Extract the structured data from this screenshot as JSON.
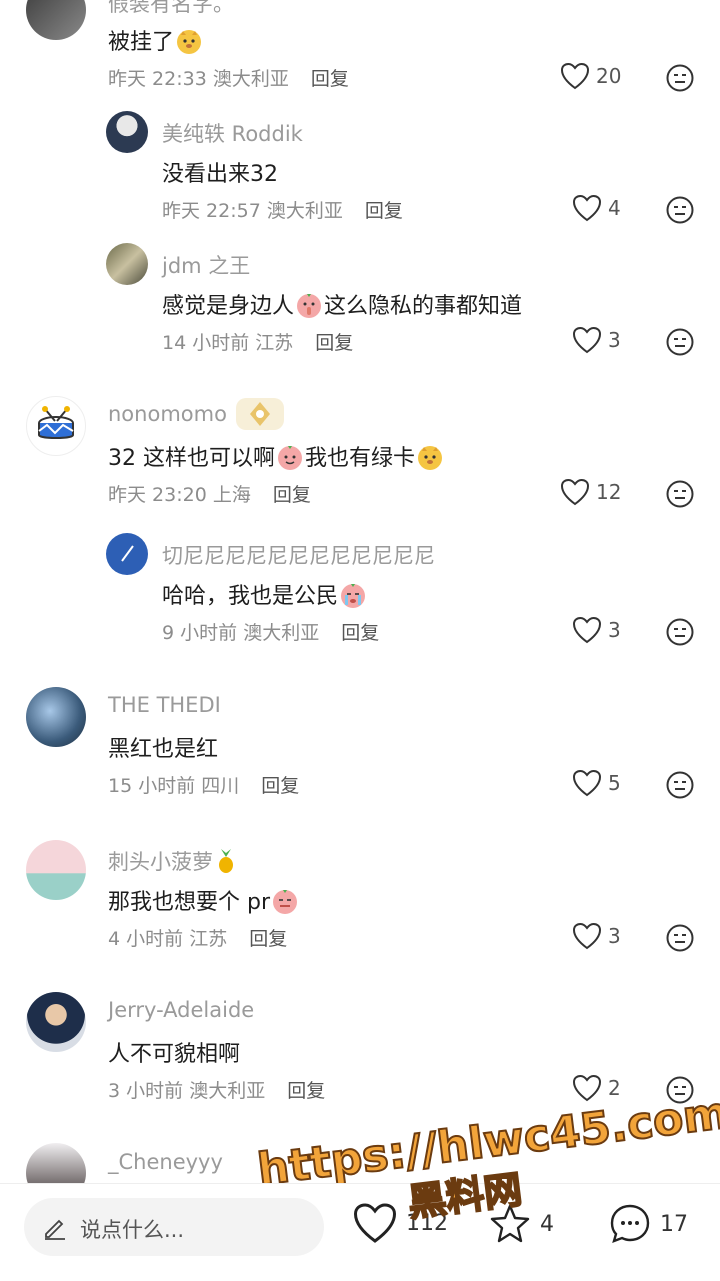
{
  "comments": [
    {
      "author": "假装有名字。",
      "text": "被挂了",
      "time": "昨天 22:33",
      "location": "澳大利亚",
      "reply_label": "回复",
      "likes": "20"
    },
    {
      "author": "美纯轶 Roddik",
      "text": "没看出来32",
      "time": "昨天 22:57",
      "location": "澳大利亚",
      "reply_label": "回复",
      "likes": "4"
    },
    {
      "author": "jdm 之王",
      "text_a": "感觉是身边人",
      "text_b": "这么隐私的事都知道",
      "time": "14 小时前",
      "location": "江苏",
      "reply_label": "回复",
      "likes": "3"
    },
    {
      "author": "nonomomo",
      "text_a": "32 这样也可以啊",
      "text_b": "我也有绿卡",
      "time": "昨天 23:20",
      "location": "上海",
      "reply_label": "回复",
      "likes": "12"
    },
    {
      "author": "切尼尼尼尼尼尼尼尼尼尼尼尼",
      "text": "哈哈，我也是公民",
      "time": "9 小时前",
      "location": "澳大利亚",
      "reply_label": "回复",
      "likes": "3"
    },
    {
      "author": "THE THEDI",
      "text": "黑红也是红",
      "time": "15 小时前",
      "location": "四川",
      "reply_label": "回复",
      "likes": "5"
    },
    {
      "author": "刺头小菠萝",
      "text": "那我也想要个 pr",
      "time": "4 小时前",
      "location": "江苏",
      "reply_label": "回复",
      "likes": "3"
    },
    {
      "author": "Jerry-Adelaide",
      "text": "人不可貌相啊",
      "time": "3 小时前",
      "location": "澳大利亚",
      "reply_label": "回复",
      "likes": "2"
    },
    {
      "author": "_Cheneyyy"
    }
  ],
  "bottom_bar": {
    "input_placeholder": "说点什么...",
    "like_count": "112",
    "favorite_count": "4",
    "comment_count": "17"
  },
  "watermark": {
    "url": "https://hlwc45.com",
    "name": "黑料网"
  },
  "colors": {
    "accent": "#f2a43a",
    "muted": "#9a9a9a",
    "icon": "#333333"
  }
}
